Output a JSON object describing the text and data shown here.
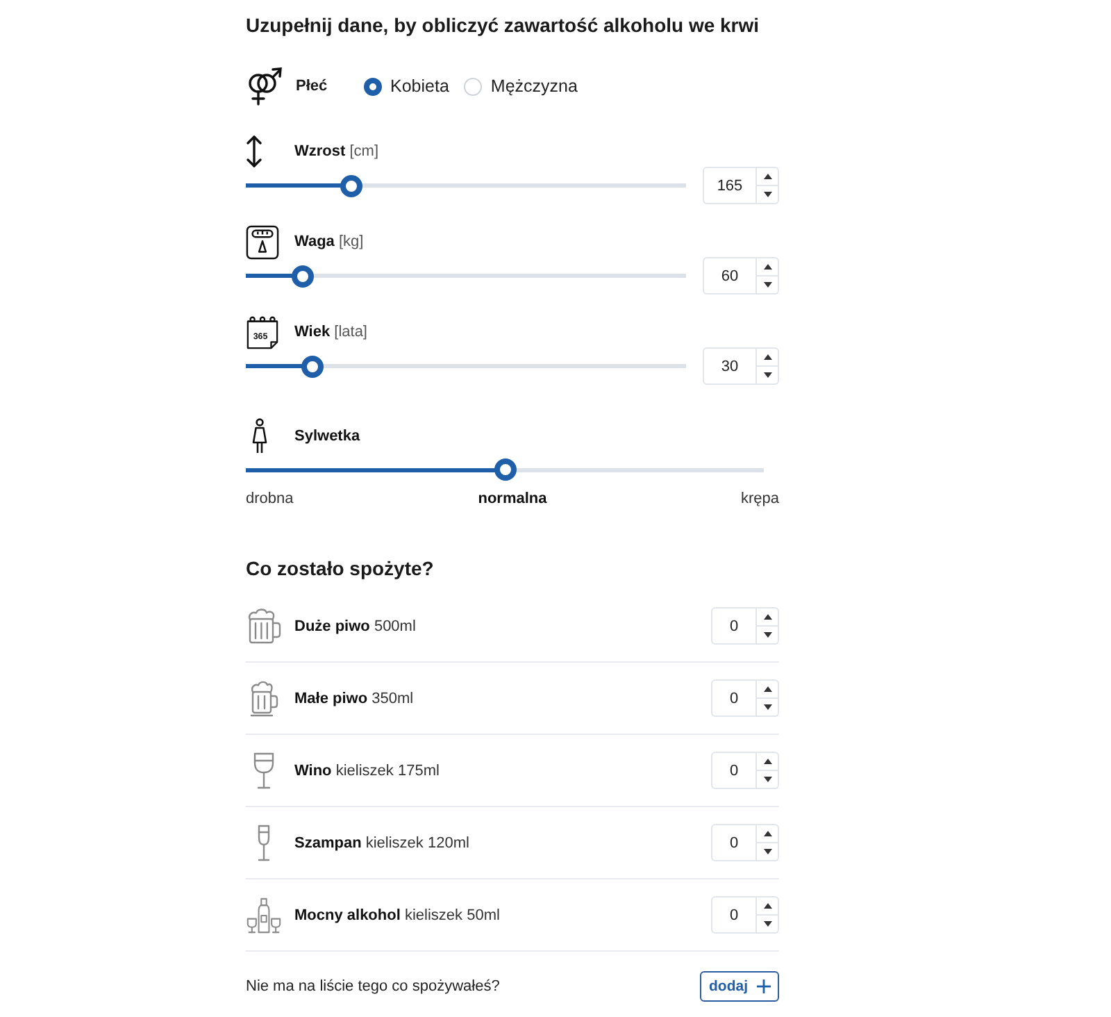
{
  "title": "Uzupełnij dane, by obliczyć zawartość alkoholu we krwi",
  "gender": {
    "label": "Płeć",
    "options": [
      {
        "label": "Kobieta",
        "selected": true
      },
      {
        "label": "Mężczyzna",
        "selected": false
      }
    ]
  },
  "sliders": [
    {
      "kind": "height",
      "label": "Wzrost",
      "unit": "[cm]",
      "level": 0.24,
      "value": "165"
    },
    {
      "kind": "weight",
      "label": "Waga",
      "unit": "[kg]",
      "level": 0.13,
      "value": "60"
    },
    {
      "kind": "age",
      "label": "Wiek",
      "unit": "[lata]",
      "icon_text": "365",
      "level": 0.15,
      "value": "30"
    }
  ],
  "figure": {
    "label": "Sylwetka",
    "level": 0.5,
    "scale": [
      {
        "label": "drobna",
        "selected": false
      },
      {
        "label": "normalna",
        "selected": true
      },
      {
        "label": "krępa",
        "selected": false
      }
    ]
  },
  "consumed": {
    "heading": "Co zostało spożyte?",
    "items": [
      {
        "kind": "large-beer",
        "name": "Duże piwo",
        "portion": "500ml",
        "value": "0"
      },
      {
        "kind": "small-beer",
        "name": "Małe piwo",
        "portion": "350ml",
        "value": "0"
      },
      {
        "kind": "wine",
        "name": "Wino",
        "portion": "kieliszek 175ml",
        "value": "0"
      },
      {
        "kind": "champagne",
        "name": "Szampan",
        "portion": "kieliszek 120ml",
        "value": "0"
      },
      {
        "kind": "spirits",
        "name": "Mocny alkohol",
        "portion": "kieliszek 50ml",
        "value": "0"
      }
    ],
    "footer": {
      "prompt": "Nie ma na liście tego co spożywałeś?",
      "button": "dodaj"
    }
  }
}
